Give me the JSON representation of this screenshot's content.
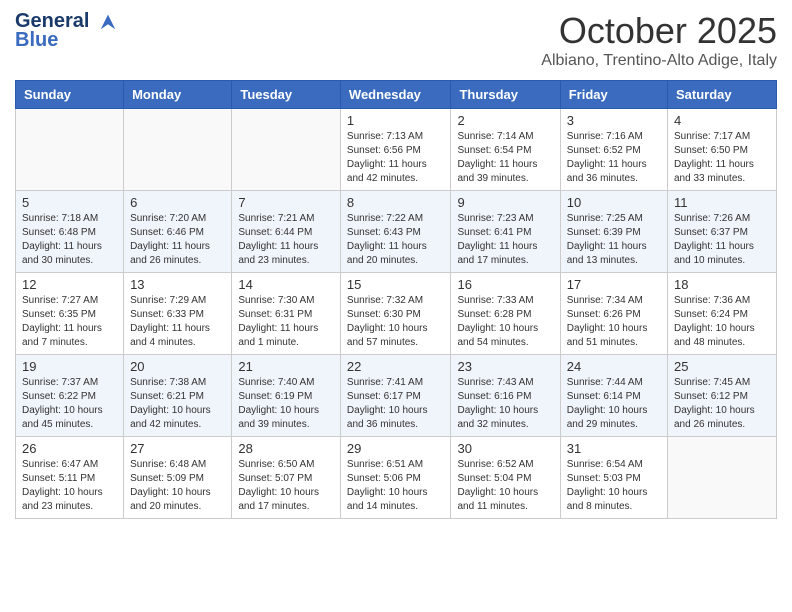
{
  "header": {
    "logo_line1": "General",
    "logo_line2": "Blue",
    "month": "October 2025",
    "location": "Albiano, Trentino-Alto Adige, Italy"
  },
  "weekdays": [
    "Sunday",
    "Monday",
    "Tuesday",
    "Wednesday",
    "Thursday",
    "Friday",
    "Saturday"
  ],
  "weeks": [
    [
      {
        "day": "",
        "info": ""
      },
      {
        "day": "",
        "info": ""
      },
      {
        "day": "",
        "info": ""
      },
      {
        "day": "1",
        "info": "Sunrise: 7:13 AM\nSunset: 6:56 PM\nDaylight: 11 hours and 42 minutes."
      },
      {
        "day": "2",
        "info": "Sunrise: 7:14 AM\nSunset: 6:54 PM\nDaylight: 11 hours and 39 minutes."
      },
      {
        "day": "3",
        "info": "Sunrise: 7:16 AM\nSunset: 6:52 PM\nDaylight: 11 hours and 36 minutes."
      },
      {
        "day": "4",
        "info": "Sunrise: 7:17 AM\nSunset: 6:50 PM\nDaylight: 11 hours and 33 minutes."
      }
    ],
    [
      {
        "day": "5",
        "info": "Sunrise: 7:18 AM\nSunset: 6:48 PM\nDaylight: 11 hours and 30 minutes."
      },
      {
        "day": "6",
        "info": "Sunrise: 7:20 AM\nSunset: 6:46 PM\nDaylight: 11 hours and 26 minutes."
      },
      {
        "day": "7",
        "info": "Sunrise: 7:21 AM\nSunset: 6:44 PM\nDaylight: 11 hours and 23 minutes."
      },
      {
        "day": "8",
        "info": "Sunrise: 7:22 AM\nSunset: 6:43 PM\nDaylight: 11 hours and 20 minutes."
      },
      {
        "day": "9",
        "info": "Sunrise: 7:23 AM\nSunset: 6:41 PM\nDaylight: 11 hours and 17 minutes."
      },
      {
        "day": "10",
        "info": "Sunrise: 7:25 AM\nSunset: 6:39 PM\nDaylight: 11 hours and 13 minutes."
      },
      {
        "day": "11",
        "info": "Sunrise: 7:26 AM\nSunset: 6:37 PM\nDaylight: 11 hours and 10 minutes."
      }
    ],
    [
      {
        "day": "12",
        "info": "Sunrise: 7:27 AM\nSunset: 6:35 PM\nDaylight: 11 hours and 7 minutes."
      },
      {
        "day": "13",
        "info": "Sunrise: 7:29 AM\nSunset: 6:33 PM\nDaylight: 11 hours and 4 minutes."
      },
      {
        "day": "14",
        "info": "Sunrise: 7:30 AM\nSunset: 6:31 PM\nDaylight: 11 hours and 1 minute."
      },
      {
        "day": "15",
        "info": "Sunrise: 7:32 AM\nSunset: 6:30 PM\nDaylight: 10 hours and 57 minutes."
      },
      {
        "day": "16",
        "info": "Sunrise: 7:33 AM\nSunset: 6:28 PM\nDaylight: 10 hours and 54 minutes."
      },
      {
        "day": "17",
        "info": "Sunrise: 7:34 AM\nSunset: 6:26 PM\nDaylight: 10 hours and 51 minutes."
      },
      {
        "day": "18",
        "info": "Sunrise: 7:36 AM\nSunset: 6:24 PM\nDaylight: 10 hours and 48 minutes."
      }
    ],
    [
      {
        "day": "19",
        "info": "Sunrise: 7:37 AM\nSunset: 6:22 PM\nDaylight: 10 hours and 45 minutes."
      },
      {
        "day": "20",
        "info": "Sunrise: 7:38 AM\nSunset: 6:21 PM\nDaylight: 10 hours and 42 minutes."
      },
      {
        "day": "21",
        "info": "Sunrise: 7:40 AM\nSunset: 6:19 PM\nDaylight: 10 hours and 39 minutes."
      },
      {
        "day": "22",
        "info": "Sunrise: 7:41 AM\nSunset: 6:17 PM\nDaylight: 10 hours and 36 minutes."
      },
      {
        "day": "23",
        "info": "Sunrise: 7:43 AM\nSunset: 6:16 PM\nDaylight: 10 hours and 32 minutes."
      },
      {
        "day": "24",
        "info": "Sunrise: 7:44 AM\nSunset: 6:14 PM\nDaylight: 10 hours and 29 minutes."
      },
      {
        "day": "25",
        "info": "Sunrise: 7:45 AM\nSunset: 6:12 PM\nDaylight: 10 hours and 26 minutes."
      }
    ],
    [
      {
        "day": "26",
        "info": "Sunrise: 6:47 AM\nSunset: 5:11 PM\nDaylight: 10 hours and 23 minutes."
      },
      {
        "day": "27",
        "info": "Sunrise: 6:48 AM\nSunset: 5:09 PM\nDaylight: 10 hours and 20 minutes."
      },
      {
        "day": "28",
        "info": "Sunrise: 6:50 AM\nSunset: 5:07 PM\nDaylight: 10 hours and 17 minutes."
      },
      {
        "day": "29",
        "info": "Sunrise: 6:51 AM\nSunset: 5:06 PM\nDaylight: 10 hours and 14 minutes."
      },
      {
        "day": "30",
        "info": "Sunrise: 6:52 AM\nSunset: 5:04 PM\nDaylight: 10 hours and 11 minutes."
      },
      {
        "day": "31",
        "info": "Sunrise: 6:54 AM\nSunset: 5:03 PM\nDaylight: 10 hours and 8 minutes."
      },
      {
        "day": "",
        "info": ""
      }
    ]
  ]
}
